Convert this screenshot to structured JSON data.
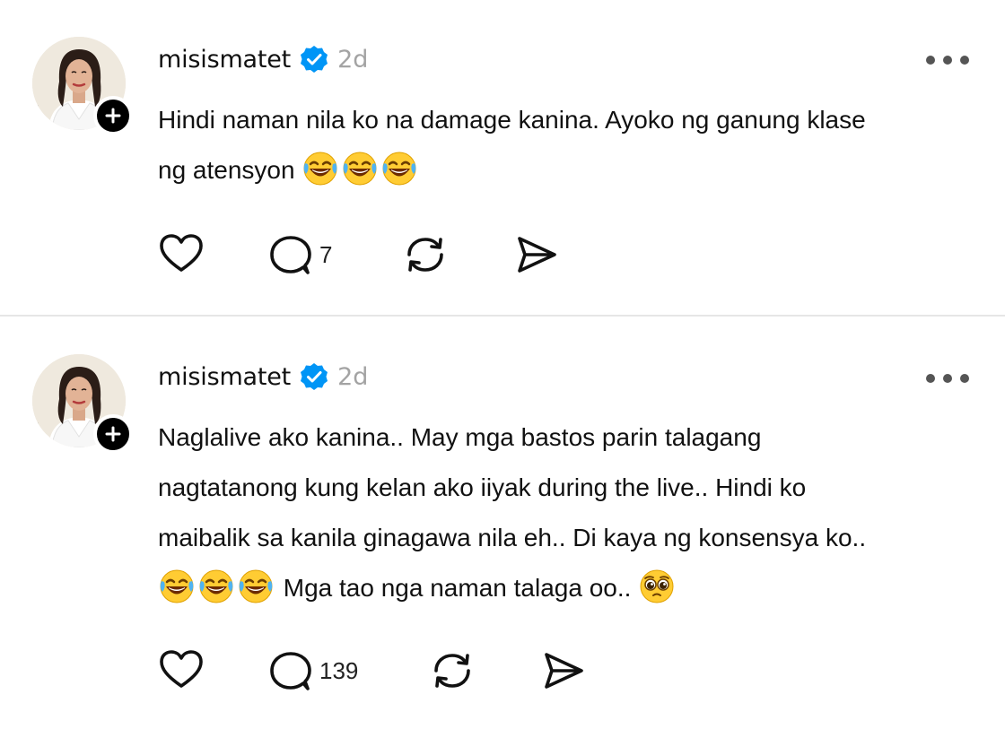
{
  "posts": [
    {
      "username": "misismatet",
      "timestamp": "2d",
      "text_lines": [
        "Hindi naman nila ko na damage kanina. Ayoko ng ganung klase",
        "ng atensyon"
      ],
      "line2_emojis": [
        "face-with-tears-of-joy",
        "face-with-tears-of-joy",
        "face-with-tears-of-joy"
      ],
      "reply_count": "7"
    },
    {
      "username": "misismatet",
      "timestamp": "2d",
      "text_lines": [
        "Naglalive ako kanina.. May mga bastos parin talagang",
        "nagtatanong kung kelan ako iiyak during the live.. Hindi ko",
        "maibalik sa kanila ginagawa nila eh.. Di kaya ng konsensya ko..",
        "Mga tao nga naman talaga oo.."
      ],
      "line4_emojis_before": [
        "face-with-tears-of-joy",
        "face-with-tears-of-joy",
        "face-with-tears-of-joy"
      ],
      "line4_emoji_after": "pleading-face",
      "reply_count": "139"
    }
  ],
  "colors": {
    "verified": "#0095f6",
    "timestamp": "#a3a3a3",
    "divider": "#e6e6e6",
    "icon": "#111111"
  },
  "icons": {
    "like": "heart-icon",
    "reply": "speech-bubble-icon",
    "repost": "repost-icon",
    "share": "send-icon",
    "more": "more-dots-icon",
    "follow": "plus-icon",
    "verified": "verified-badge-icon"
  }
}
